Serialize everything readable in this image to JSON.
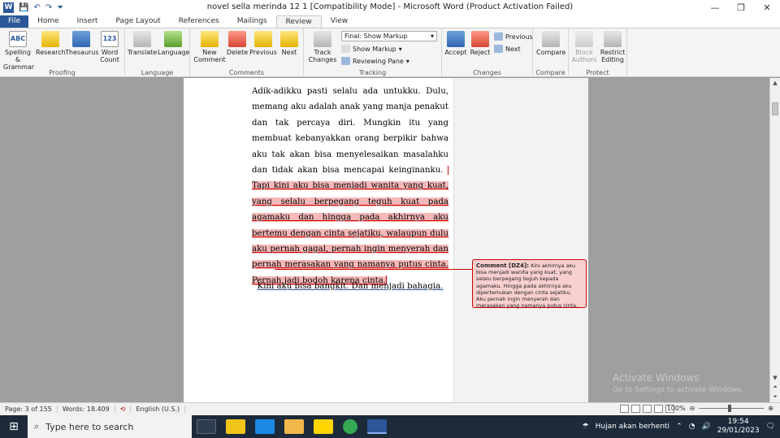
{
  "window": {
    "title": "novel sella merinda 12 1 [Compatibility Mode]  -  Microsoft Word (Product Activation Failed)",
    "controls": {
      "minimize": "—",
      "maximize": "❐",
      "close": "✕"
    }
  },
  "quick_access": {
    "logo": "W",
    "save": "💾",
    "undo": "↶",
    "redo": "↷",
    "more": "⏷"
  },
  "tabs": [
    "File",
    "Home",
    "Insert",
    "Page Layout",
    "References",
    "Mailings",
    "Review",
    "View"
  ],
  "active_tab": "Review",
  "ribbon": {
    "proofing": {
      "label": "Proofing",
      "spelling": "Spelling & Grammar",
      "research": "Research",
      "thesaurus": "Thesaurus",
      "word_count": "Word Count"
    },
    "language": {
      "label": "Language",
      "translate": "Translate",
      "language": "Language"
    },
    "comments": {
      "label": "Comments",
      "new_comment": "New Comment",
      "delete": "Delete",
      "previous": "Previous",
      "next": "Next"
    },
    "tracking": {
      "label": "Tracking",
      "track_changes": "Track Changes",
      "display": "Final: Show Markup",
      "show_markup": "Show Markup",
      "reviewing_pane": "Reviewing Pane"
    },
    "changes": {
      "label": "Changes",
      "accept": "Accept",
      "reject": "Reject",
      "previous": "Previous",
      "next": "Next"
    },
    "compare": {
      "label": "Compare",
      "compare": "Compare"
    },
    "protect": {
      "label": "Protect",
      "block_authors": "Block Authors",
      "restrict_editing": "Restrict Editing"
    }
  },
  "document": {
    "paragraph_plain": "Adik-adikku pasti selalu ada untukku. Dulu, memang aku adalah anak yang manja penakut dan tak percaya diri. Mungkin itu yang membuat kebanyakkan orang berpikir bahwa aku tak akan bisa menyelesaikan masalahku dan tidak akan bisa mencapai keinginanku. ",
    "paragraph_highlighted": "Tapi kini aku bisa menjadi wanita yang kuat, yang selalu berpegang teguh kuat pada agamaku dan hingga pada akhirnya aku bertemu dengan cinta sejatiku, walaupun dulu aku pernah gagal, pernah ingin menyerah dan pernah merasakan yang namanya putus cinta. Pernah jadi bodoh karena cinta.",
    "center_line": "Kini aku bisa bangkit. Dan menjadi bahagia."
  },
  "comment": {
    "label": "Comment [DZ4]:",
    "text": "Kini akhirnya aku bisa menjadi wanita yang kuat, yang selalu berpegang teguh kepada agamaku. Hingga pada akhirnya aku dipertemukan dengan cinta sejatiku. Aku pernah ingin menyerah dan merasakan yang namanya putus cinta."
  },
  "watermark": {
    "line1": "Activate Windows",
    "line2": "Go to Settings to activate Windows."
  },
  "statusbar": {
    "page": "Page: 3 of 155",
    "words": "Words: 18.409",
    "language": "English (U.S.)",
    "zoom": "100%",
    "zoom_level": 1.0
  },
  "taskbar": {
    "search_placeholder": "Type here to search",
    "weather": "Hujan akan berhenti",
    "time": "19:54",
    "date": "29/01/2023"
  },
  "colors": {
    "accent": "#2b579a",
    "comment_border": "#cc0000",
    "comment_fill": "#f9d0d0",
    "highlight": "#f6b8b8"
  }
}
